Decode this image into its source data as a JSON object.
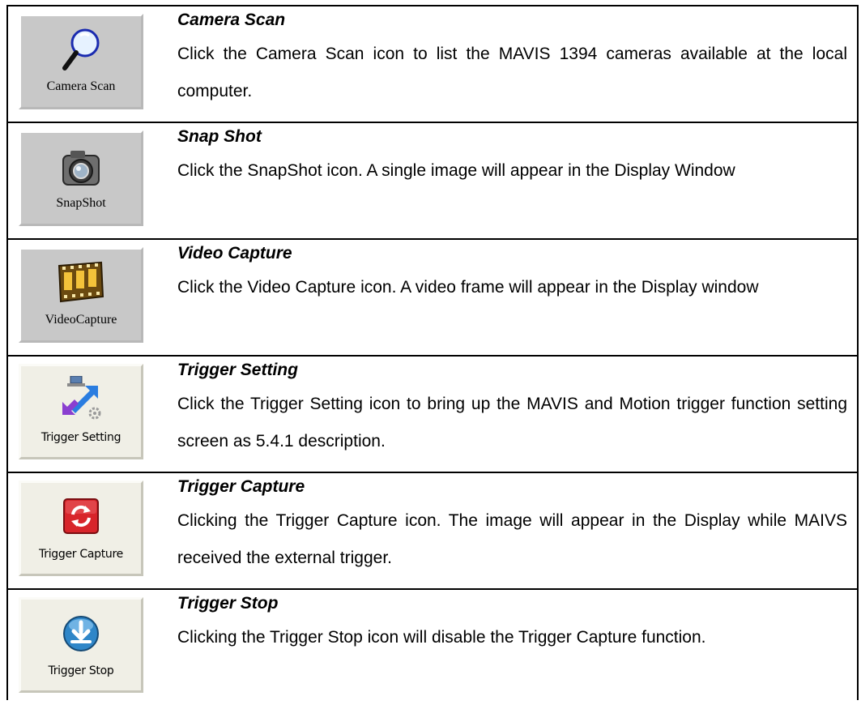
{
  "items": [
    {
      "button_label": "Camera Scan",
      "title": "Camera Scan",
      "description": "Click the Camera Scan icon to list the MAVIS 1394 cameras available at the local computer.",
      "icon": "magnifier-icon"
    },
    {
      "button_label": "SnapShot",
      "title": "Snap Shot",
      "description": "Click the SnapShot icon. A single image will appear in the Display Window",
      "icon": "camera-icon"
    },
    {
      "button_label": "VideoCapture",
      "title": "Video Capture",
      "description": "Click the Video Capture icon. A video frame will appear in the Display window",
      "icon": "film-icon"
    },
    {
      "button_label": "Trigger Setting",
      "title": "Trigger Setting",
      "description": "Click the Trigger Setting icon to bring up the MAVIS and Motion trigger function setting screen as 5.4.1 description.",
      "icon": "trigger-setting-icon"
    },
    {
      "button_label": "Trigger Capture",
      "title": "Trigger Capture",
      "description": "Clicking the Trigger Capture icon. The image will appear in the Display while MAIVS received the external trigger.",
      "icon": "refresh-icon"
    },
    {
      "button_label": "Trigger Stop",
      "title": "Trigger Stop",
      "description": "Clicking the Trigger Stop icon will disable the Trigger Capture function.",
      "icon": "download-icon"
    }
  ],
  "colors": {
    "classic_button": "#c8c8c8",
    "modern_button": "#f0efe6",
    "border": "#000000"
  }
}
